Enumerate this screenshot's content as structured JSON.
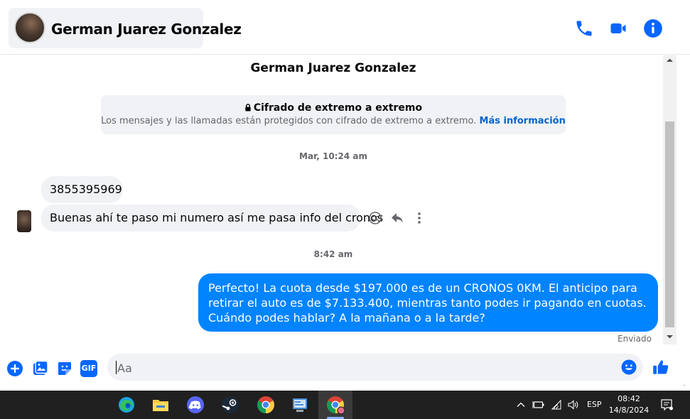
{
  "header": {
    "contact_name": "German Juarez Gonzalez",
    "icons": [
      "phone-icon",
      "video-icon",
      "info-icon"
    ]
  },
  "thread": {
    "name": "German Juarez Gonzalez",
    "encryption": {
      "title": "Cifrado de extremo a extremo",
      "text": "Los mensajes y las llamadas están protegidos con cifrado de extremo a extremo.",
      "link": "Más información"
    },
    "timestamps": [
      "Mar, 10:24 am",
      "8:42 am"
    ],
    "messages_in": [
      "3855395969",
      "Buenas ahí te paso mi numero así me pasa info del cronos"
    ],
    "message_out": "Perfecto! La cuota desde $197.000 es de un CRONOS 0KM. El anticipo para retirar el auto es de $7.133.400, mientras tanto podes ir pagando en cuotas. Cuándo podes hablar? A la mañana o a la tarde?",
    "sent_status": "Enviado"
  },
  "composer": {
    "placeholder": "Aa",
    "gif_label": "GIF"
  },
  "colors": {
    "accent": "#0084ff",
    "icon_blue": "#0866ff",
    "bubble_gray": "#f0f2f5",
    "taskbar": "#202020"
  },
  "taskbar": {
    "apps": [
      "edge-icon",
      "file-explorer-icon",
      "discord-icon",
      "steam-icon",
      "chrome-icon",
      "app-window-icon",
      "chrome-profile-icon"
    ],
    "language": "ESP",
    "time": "08:42",
    "date": "14/8/2024"
  }
}
